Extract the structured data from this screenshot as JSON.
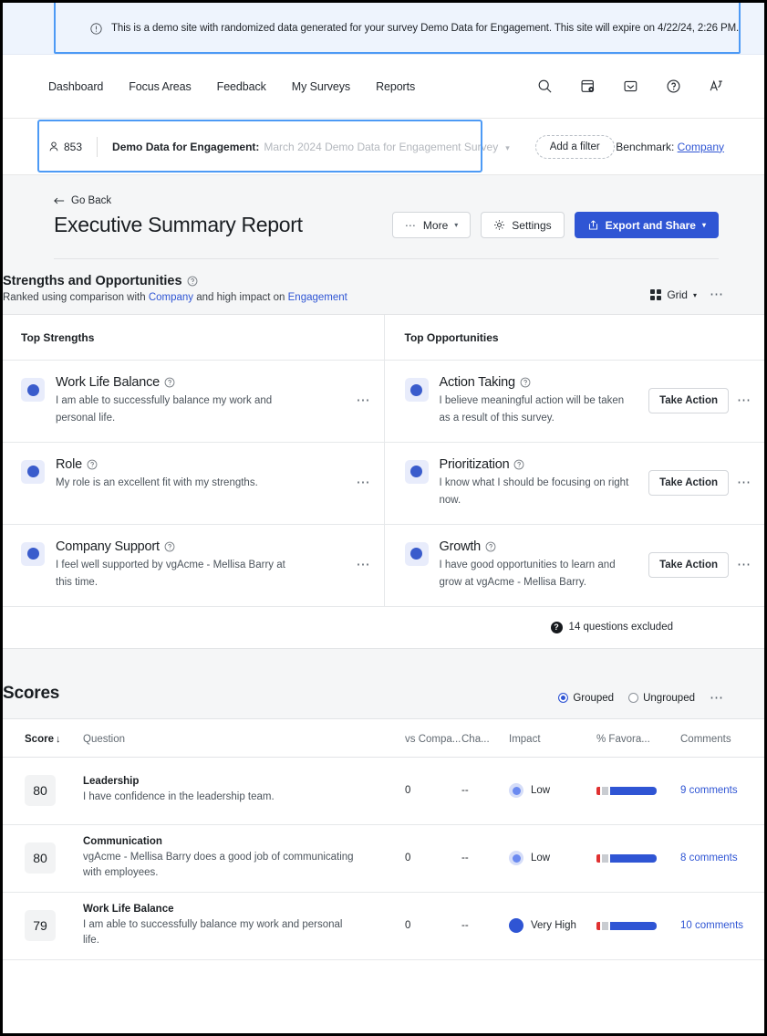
{
  "banner": {
    "icon": "alert-circle-icon",
    "text": "This is a demo site with randomized data generated for your survey Demo Data for Engagement. This site will expire on 4/22/24, 2:26 PM."
  },
  "nav": {
    "links": [
      {
        "label": "Dashboard"
      },
      {
        "label": "Focus Areas"
      },
      {
        "label": "Feedback"
      },
      {
        "label": "My Surveys"
      },
      {
        "label": "Reports"
      }
    ],
    "icons": [
      "search-icon",
      "admin-panel-icon",
      "inbox-icon",
      "help-circle-icon",
      "translate-icon"
    ]
  },
  "filterbar": {
    "respondent_count": "853",
    "survey_label": "Demo Data for Engagement:",
    "survey_value": "March 2024 Demo Data for Engagement Survey",
    "add_filter_label": "Add a filter",
    "benchmark_label": "Benchmark:",
    "benchmark_value": "Company"
  },
  "report": {
    "go_back": "Go Back",
    "title": "Executive Summary Report",
    "more_label": "More",
    "settings_label": "Settings",
    "export_label": "Export and Share"
  },
  "strengths_section": {
    "title": "Strengths and Opportunities",
    "subtitle_prefix": "Ranked using comparison with",
    "subtitle_link1": "Company",
    "subtitle_middle": "and high impact on",
    "subtitle_link2": "Engagement",
    "view_label": "Grid",
    "col_left": "Top Strengths",
    "col_right": "Top Opportunities",
    "take_action_label": "Take Action",
    "excluded_text": "14 questions excluded",
    "excluded_badge": "?",
    "strengths": [
      {
        "name": "Work Life Balance",
        "desc": "I am able to successfully balance my work and personal life."
      },
      {
        "name": "Role",
        "desc": "My role is an excellent fit with my strengths."
      },
      {
        "name": "Company Support",
        "desc": "I feel well supported by vgAcme - Mellisa Barry at this time."
      }
    ],
    "opportunities": [
      {
        "name": "Action Taking",
        "desc": "I believe meaningful action will be taken as a result of this survey."
      },
      {
        "name": "Prioritization",
        "desc": "I know what I should be focusing on right now."
      },
      {
        "name": "Growth",
        "desc": "I have good opportunities to learn and grow at vgAcme - Mellisa Barry."
      }
    ]
  },
  "scores_section": {
    "title": "Scores",
    "grouped_label": "Grouped",
    "ungrouped_label": "Ungrouped",
    "grouped_selected": true,
    "columns": {
      "score": "Score",
      "question": "Question",
      "vs_company": "vs Compa...",
      "change": "Cha...",
      "impact": "Impact",
      "favorable": "% Favora...",
      "comments": "Comments"
    },
    "rows": [
      {
        "score": "80",
        "question_title": "Leadership",
        "question_desc": "I have confidence in the leadership team.",
        "vs_company": "0",
        "change": "--",
        "impact": "Low",
        "impact_level": "low",
        "fav_negative": 4,
        "fav_neutral": 7,
        "fav_positive": 57,
        "comments": "9 comments"
      },
      {
        "score": "80",
        "question_title": "Communication",
        "question_desc": "vgAcme - Mellisa Barry does a good job of communicating with employees.",
        "vs_company": "0",
        "change": "--",
        "impact": "Low",
        "impact_level": "low",
        "fav_negative": 4,
        "fav_neutral": 7,
        "fav_positive": 57,
        "comments": "8 comments"
      },
      {
        "score": "79",
        "question_title": "Work Life Balance",
        "question_desc": "I am able to successfully balance my work and personal life.",
        "vs_company": "0",
        "change": "--",
        "impact": "Very High",
        "impact_level": "veryhigh",
        "fav_negative": 4,
        "fav_neutral": 7,
        "fav_positive": 57,
        "comments": "10 comments"
      }
    ]
  },
  "colors": {
    "accent_blue": "#2f55d4",
    "banner_bg": "#eef4fd",
    "highlight_outline": "#4d9af5",
    "dot_blue": "#3a5ccc",
    "negative_red": "#e03131",
    "neutral_gray": "#c9ccd1"
  }
}
